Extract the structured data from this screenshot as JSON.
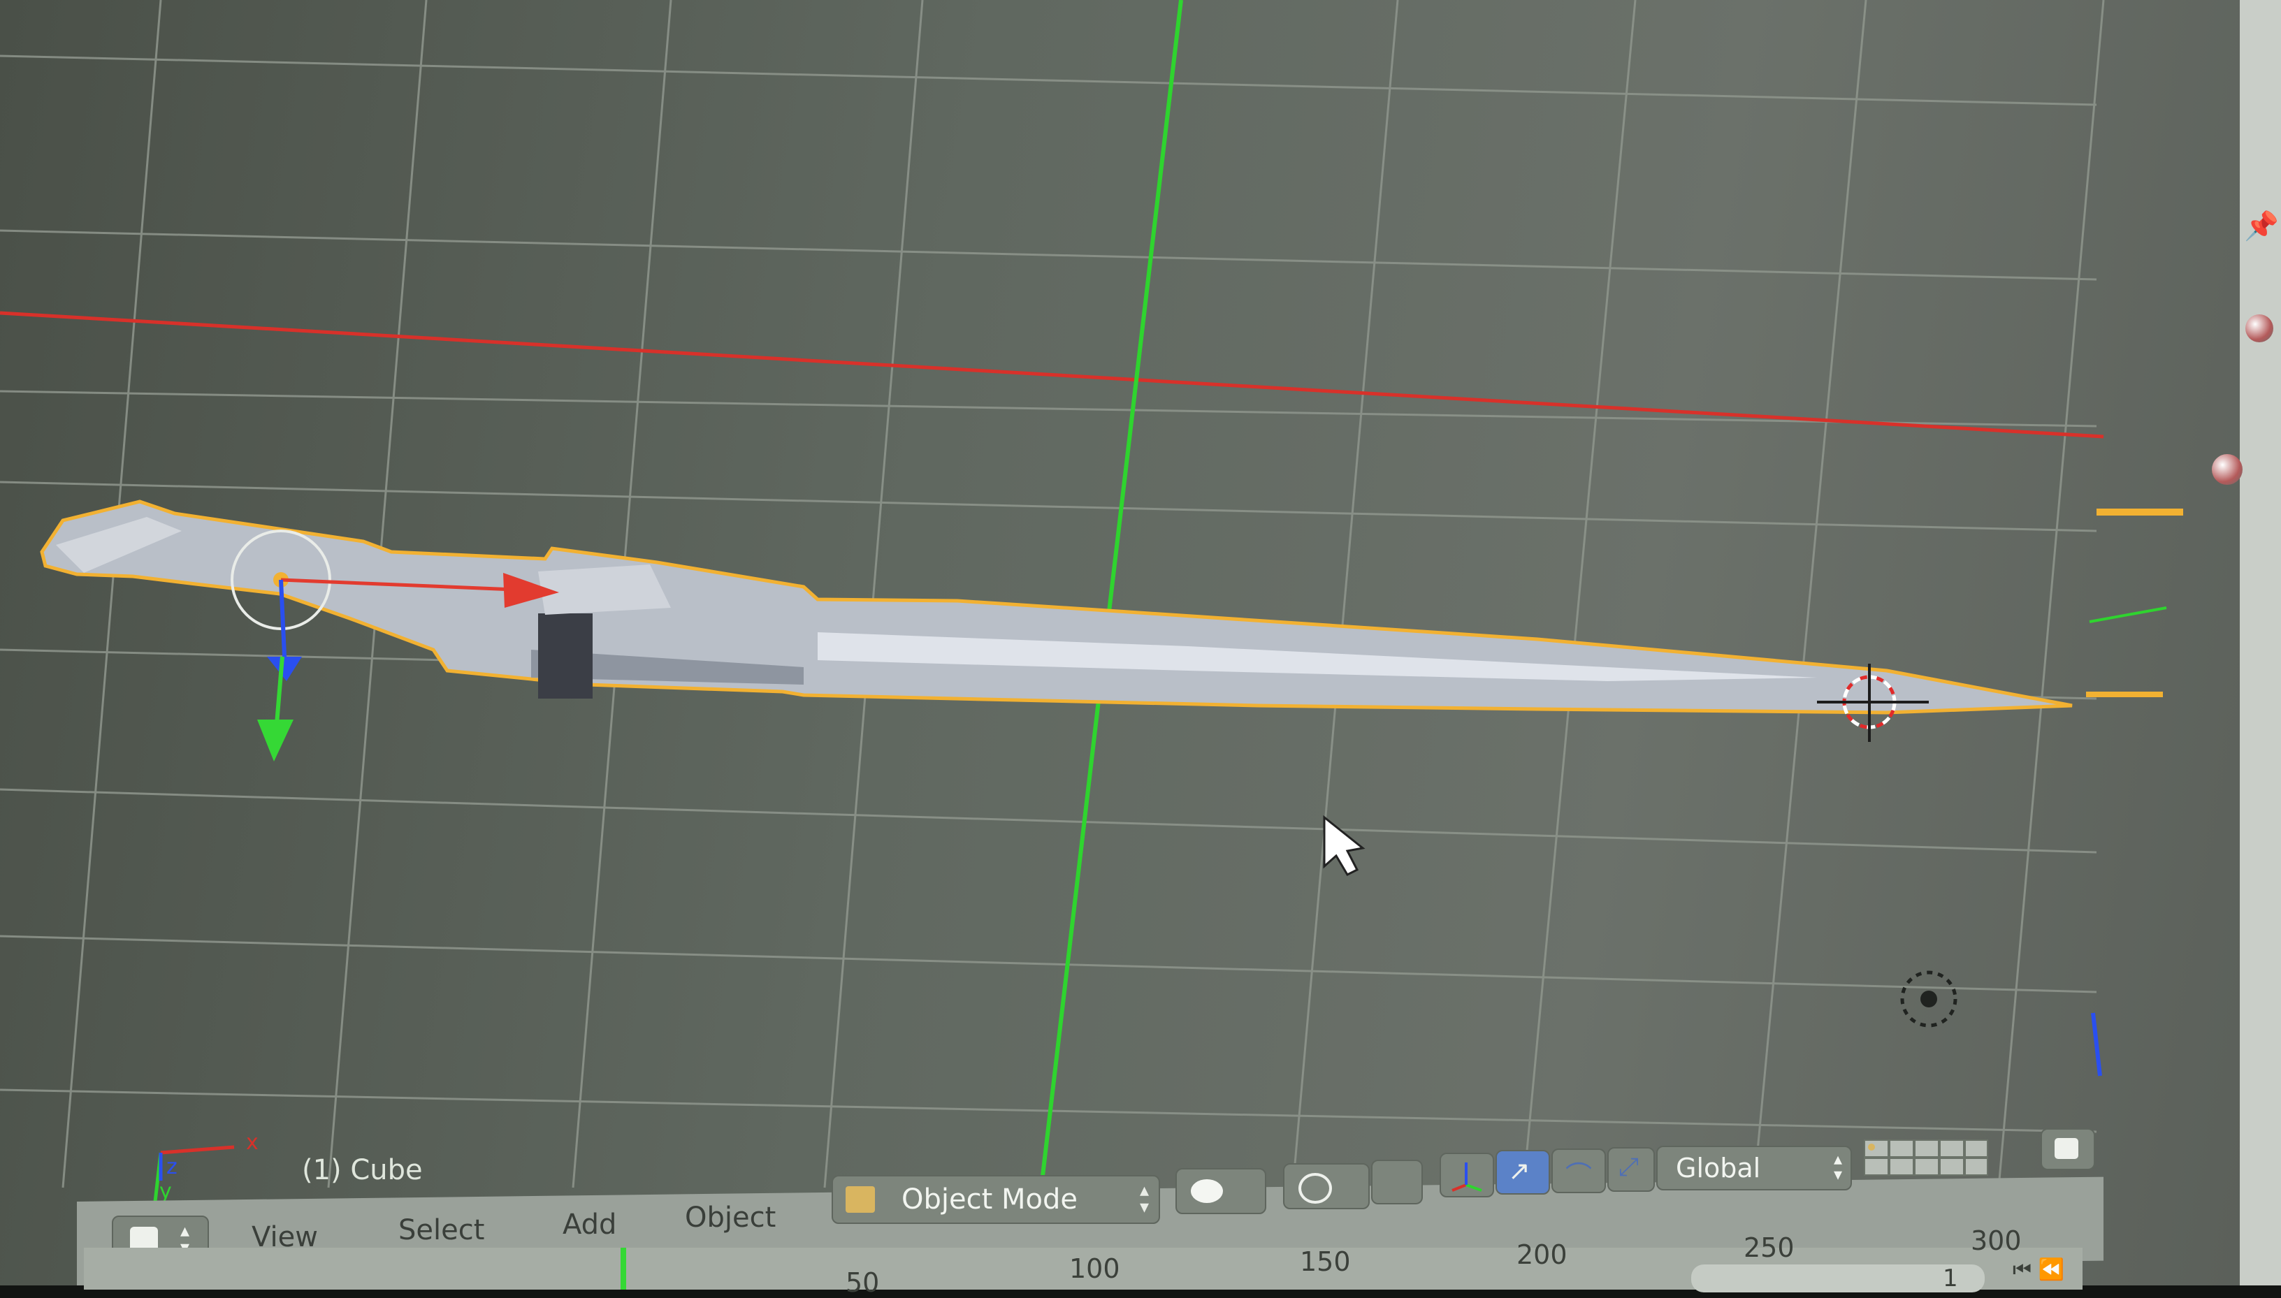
{
  "viewport": {
    "object_label": "(1) Cube",
    "axis_x_letter": "x",
    "axis_y_letter": "y",
    "axis_z_letter": "z",
    "colors": {
      "x_axis": "#d8312a",
      "y_axis": "#2fd42f",
      "selection_outline": "#f2b132",
      "grid": "#8c938a"
    }
  },
  "header": {
    "editor_type_icon": "cube-icon",
    "menus": [
      "View",
      "Select",
      "Add",
      "Object"
    ],
    "mode": "Object Mode",
    "orientation": "Global",
    "icons": [
      "viewport-shading-icon",
      "overlay-icon",
      "manipulator-translate-icon",
      "manipulator-rotate-icon",
      "manipulator-scale-icon",
      "layers-icon"
    ]
  },
  "timeline": {
    "ticks": [
      "50",
      "100",
      "150",
      "200",
      "250",
      "300"
    ],
    "current_frame": "1"
  }
}
